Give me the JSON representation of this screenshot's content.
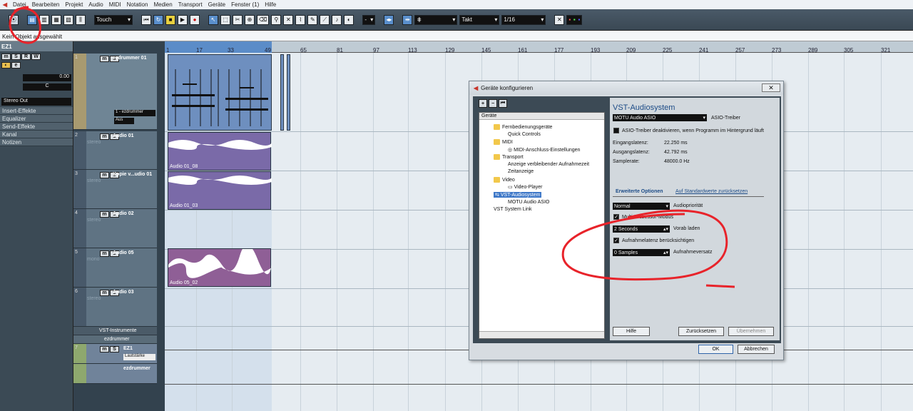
{
  "menubar": {
    "items": [
      "Datei",
      "Bearbeiten",
      "Projekt",
      "Audio",
      "MIDI",
      "Notation",
      "Medien",
      "Transport",
      "Geräte",
      "Fenster (1)",
      "Hilfe"
    ]
  },
  "toolbar": {
    "automation_mode": "Touch",
    "grid_type": "Takt",
    "quantize": "1/16",
    "snap_value": "-"
  },
  "infoline": {
    "text": "Kein Objekt ausgewählt"
  },
  "inspector": {
    "track_name": "EZ1",
    "volume": "0.00",
    "pan": "C",
    "output": "Stereo Out",
    "sections": [
      "Insert-Effekte",
      "Equalizer",
      "Send-Effekte",
      "Kanal",
      "Notizen"
    ]
  },
  "tracks": [
    {
      "num": "1",
      "name": "ezdrummer 01",
      "sub": "",
      "out": "1 - ezdrummer",
      "in": "Aus"
    },
    {
      "num": "2",
      "name": "Audio 01",
      "sub": "stereo"
    },
    {
      "num": "3",
      "name": "Kopie v...udio 01",
      "sub": "stereo"
    },
    {
      "num": "4",
      "name": "Audio 02",
      "sub": "stereo"
    },
    {
      "num": "5",
      "name": "Audio 05",
      "sub": "mono"
    },
    {
      "num": "6",
      "name": "Audio 03",
      "sub": "stereo"
    }
  ],
  "folders": {
    "vst_instruments": "VST-Instrumente",
    "ezdrummer_folder": "ezdrummer",
    "ez1": "EZ1",
    "ez1_param": "Lautstärke",
    "ezdrummer_track": "ezdrummer"
  },
  "ruler": {
    "ticks": [
      "1",
      "17",
      "33",
      "49",
      "65",
      "81",
      "97",
      "113",
      "129",
      "145",
      "161",
      "177",
      "193",
      "209",
      "225",
      "241",
      "257",
      "273",
      "289",
      "305",
      "321"
    ]
  },
  "clips": [
    {
      "label": "Audio 01_08"
    },
    {
      "label": "Audio 01_03"
    },
    {
      "label": "Audio 05_02"
    }
  ],
  "dialog": {
    "title": "Geräte konfigurieren",
    "tree_header": "Geräte",
    "tree": [
      {
        "label": "Fernbedienungsgeräte",
        "level": 1,
        "folder": true
      },
      {
        "label": "Quick Controls",
        "level": 2
      },
      {
        "label": "MIDI",
        "level": 1,
        "folder": true
      },
      {
        "label": "MIDI-Anschluss-Einstellungen",
        "level": 2
      },
      {
        "label": "Transport",
        "level": 1,
        "folder": true
      },
      {
        "label": "Anzeige verbleibender Aufnahmezeit",
        "level": 2
      },
      {
        "label": "Zeitanzeige",
        "level": 2
      },
      {
        "label": "Video",
        "level": 1,
        "folder": true
      },
      {
        "label": "Video-Player",
        "level": 2
      },
      {
        "label": "VST-Audiosystem",
        "level": 1,
        "selected": true
      },
      {
        "label": "MOTU Audio ASIO",
        "level": 2
      },
      {
        "label": "VST System Link",
        "level": 1
      }
    ],
    "panel_title": "VST-Audiosystem",
    "driver": "MOTU Audio ASIO",
    "driver_label": "ASIO-Treiber",
    "deactivate_label": "ASIO-Treiber deaktivieren, wenn Programm im Hintergrund läuft",
    "input_latency_label": "Eingangslatenz:",
    "input_latency": "22.250 ms",
    "output_latency_label": "Ausgangslatenz:",
    "output_latency": "42.792 ms",
    "samplerate_label": "Samplerate:",
    "samplerate": "48000.0 Hz",
    "advanced_tab": "Erweiterte Optionen",
    "defaults_link": "Auf Standardwerte zurücksetzen",
    "priority_value": "Normal",
    "priority_label": "Audiopriorität",
    "multiprocessor_label": "Multi-Prozessor-Modus",
    "preload_value": "2 Seconds",
    "preload_label": "Vorab laden",
    "latency_comp_label": "Aufnahmelatenz berücksichtigen",
    "offset_value": "0 Samples",
    "offset_label": "Aufnahmeversatz",
    "help_btn": "Hilfe",
    "reset_btn": "Zurücksetzen",
    "apply_btn": "Übernehmen",
    "ok_btn": "OK",
    "cancel_btn": "Abbrechen"
  },
  "colors": {
    "annotation": "#e8232a",
    "selection": "#3e78c8",
    "audio_clip": "#7a6aa8",
    "midi_clip": "#6e8fbf"
  }
}
